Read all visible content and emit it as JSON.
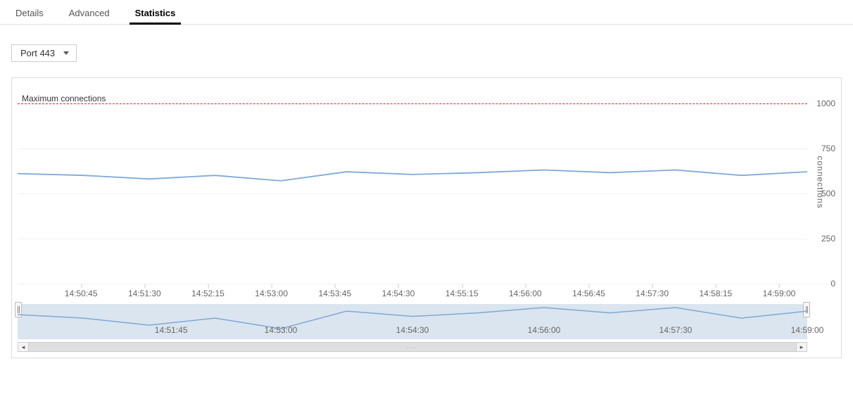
{
  "tabs": [
    {
      "label": "Details",
      "active": false
    },
    {
      "label": "Advanced",
      "active": false
    },
    {
      "label": "Statistics",
      "active": true
    }
  ],
  "port_select": {
    "label": "Port 443"
  },
  "chart_data": {
    "type": "line",
    "title": "",
    "xlabel": "",
    "ylabel": "connections",
    "ylim": [
      0,
      1100
    ],
    "y_ticks": [
      0,
      250,
      500,
      750,
      1000
    ],
    "x_ticks": [
      "14:50:45",
      "14:51:30",
      "14:52:15",
      "14:53:00",
      "14:53:45",
      "14:54:30",
      "14:55:15",
      "14:56:00",
      "14:56:45",
      "14:57:30",
      "14:58:15",
      "14:59:00"
    ],
    "threshold": {
      "label": "Maximum connections",
      "value": 1000,
      "color": "#d62728"
    },
    "series": [
      {
        "name": "connections",
        "color": "#7da9d8",
        "x": [
          "14:50:00",
          "14:50:45",
          "14:51:30",
          "14:52:15",
          "14:53:00",
          "14:53:45",
          "14:54:30",
          "14:55:15",
          "14:56:00",
          "14:56:45",
          "14:57:30",
          "14:58:15",
          "14:59:00"
        ],
        "values": [
          610,
          600,
          580,
          600,
          570,
          620,
          605,
          615,
          630,
          615,
          630,
          600,
          620
        ]
      }
    ],
    "overview_x_ticks": [
      "14:51:45",
      "14:53:00",
      "14:54:30",
      "14:56:00",
      "14:57:30",
      "14:59:00"
    ]
  }
}
